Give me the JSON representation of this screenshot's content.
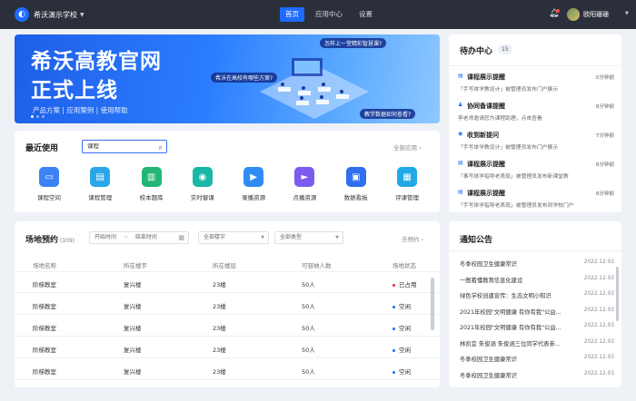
{
  "topbar": {
    "school": "希沃演示学校",
    "nav": [
      "首页",
      "应用中心",
      "设置"
    ],
    "active": "首页",
    "user": "欧阳珊珊"
  },
  "banner": {
    "line1": "希沃高教官网",
    "line2": "正式上线",
    "sub": "产品方案 | 应用案例 | 使用帮助",
    "bubble1": "怎样上一堂精彩智慧课?",
    "bubble2": "希沃在高校有哪些方案?",
    "bubble3": "教学数据如何查看?"
  },
  "recent": {
    "title": "最近使用",
    "search_value": "课程",
    "more": "全部应用",
    "apps": [
      {
        "label": "课程空间",
        "icon": "folder-icon",
        "color": "#3b82f6"
      },
      {
        "label": "课程管理",
        "icon": "book-icon",
        "color": "#2aa7e8"
      },
      {
        "label": "校本题库",
        "icon": "doc-icon",
        "color": "#22b573"
      },
      {
        "label": "实时督课",
        "icon": "eye-icon",
        "color": "#19b7a6"
      },
      {
        "label": "录播资源",
        "icon": "video-icon",
        "color": "#2f8cf4"
      },
      {
        "label": "点播资源",
        "icon": "play-icon",
        "color": "#7c5cf0"
      },
      {
        "label": "数据看板",
        "icon": "monitor-icon",
        "color": "#2f6fef"
      },
      {
        "label": "评课管理",
        "icon": "clipboard-icon",
        "color": "#21a9e6"
      }
    ]
  },
  "venue": {
    "title": "场地预约",
    "count": "(109)",
    "start_placeholder": "开始时间",
    "dash": "~",
    "end_placeholder": "结束时间",
    "filter_building": "全部楼宇",
    "filter_type": "全部类型",
    "more": "去预约",
    "headers": [
      "场地名称",
      "所在楼宇",
      "所在楼层",
      "可容纳人数",
      "场地状态"
    ],
    "rows": [
      {
        "name": "阶梯教室",
        "building": "复兴楼",
        "floor": "23楼",
        "capacity": "50人",
        "status": "已占用",
        "status_color": "#f5222d"
      },
      {
        "name": "阶梯教室",
        "building": "复兴楼",
        "floor": "23楼",
        "capacity": "50人",
        "status": "空闲",
        "status_color": "#1e6bff"
      },
      {
        "name": "阶梯教室",
        "building": "复兴楼",
        "floor": "23楼",
        "capacity": "50人",
        "status": "空闲",
        "status_color": "#1e6bff"
      },
      {
        "name": "阶梯教室",
        "building": "复兴楼",
        "floor": "23楼",
        "capacity": "50人",
        "status": "空闲",
        "status_color": "#1e6bff"
      },
      {
        "name": "阶梯教室",
        "building": "复兴楼",
        "floor": "23楼",
        "capacity": "50人",
        "status": "空闲",
        "status_color": "#1e6bff"
      }
    ]
  },
  "todo": {
    "title": "待办中心",
    "count": "15",
    "items": [
      {
        "title": "课程展示提醒",
        "time": "5分钟前",
        "desc": "「手写体学教设计」被管理员发布门户展示"
      },
      {
        "title": "协同备课提醒",
        "time": "8分钟前",
        "desc": "李老师邀请您为课程助理，点击查看"
      },
      {
        "title": "收到新提问",
        "time": "7分钟前",
        "desc": "「手写体学教设计」被管理员发布门户展示"
      },
      {
        "title": "课程展示提醒",
        "time": "8分钟前",
        "desc": "「事写体学指导老表现」被管理员发布新课堂教"
      },
      {
        "title": "课程展示提醒",
        "time": "8分钟前",
        "desc": "「手写体学指导老表现」被管理员发布到学校门户"
      }
    ]
  },
  "notice": {
    "title": "通知公告",
    "items": [
      {
        "text": "冬季校园卫生健康常识",
        "date": "2022.12.03"
      },
      {
        "text": "一图看懂教育信息化建设",
        "date": "2022.12.03"
      },
      {
        "text": "绿色学校创建宣传：生态文明小知识",
        "date": "2022.12.03"
      },
      {
        "text": "2021年校园\"文明健康 有你有我\"公益...",
        "date": "2022.12.03"
      },
      {
        "text": "2021年校园\"文明健康 有你有我\"公益...",
        "date": "2022.12.03"
      },
      {
        "text": "林凯宜 朱俊涵 朱俊涵三位同学代表参...",
        "date": "2022.12.03"
      },
      {
        "text": "冬季校园卫生健康常识",
        "date": "2022.12.03"
      },
      {
        "text": "冬季校园卫生健康常识",
        "date": "2022.12.03"
      }
    ]
  }
}
